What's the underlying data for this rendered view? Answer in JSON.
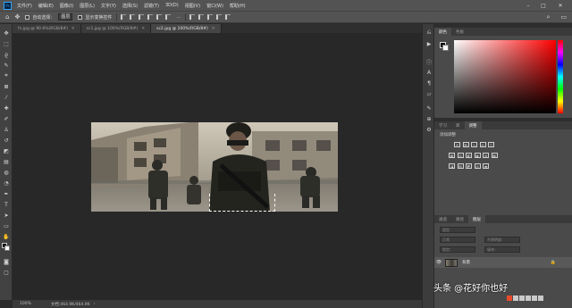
{
  "app": {
    "logo": "Ps"
  },
  "menu": [
    "文件(F)",
    "编辑(E)",
    "图像(I)",
    "图层(L)",
    "文字(Y)",
    "选择(S)",
    "滤镜(T)",
    "3D(D)",
    "视图(V)",
    "窗口(W)",
    "帮助(H)"
  ],
  "options": {
    "auto_select_label": "自动选择：",
    "auto_select_target": "图层",
    "show_transform_label": "显示变换控件",
    "more_label": "..."
  },
  "tabs": [
    {
      "label": "fn.jpg @ 90.6%(RGB/8#)",
      "active": false
    },
    {
      "label": "sc1.jpg @ 100%(RGB/8#)",
      "active": false
    },
    {
      "label": "sc2.jpg @ 100%(RGB/8#)",
      "active": true
    }
  ],
  "status": {
    "zoom": "100%",
    "doc": "文档:464.9K/464.9K"
  },
  "panels": {
    "color_tabs": [
      "颜色",
      "色板"
    ],
    "props_tabs": [
      "学习",
      "库",
      "调整"
    ],
    "adjust_title": "添加调整",
    "layers_tabs": [
      "通道",
      "路径",
      "图层"
    ],
    "layer_kind": "类型",
    "layer_mode": "正常",
    "layer_opacity": "不透明度:",
    "layer_lock": "锁定:",
    "layer_fill": "填充:",
    "layers": [
      {
        "name": "背景",
        "visible": true,
        "locked": true
      }
    ]
  },
  "watermark": "头条 @花好你也好",
  "colors": {
    "fg": "#000000",
    "bg": "#ffffff"
  }
}
